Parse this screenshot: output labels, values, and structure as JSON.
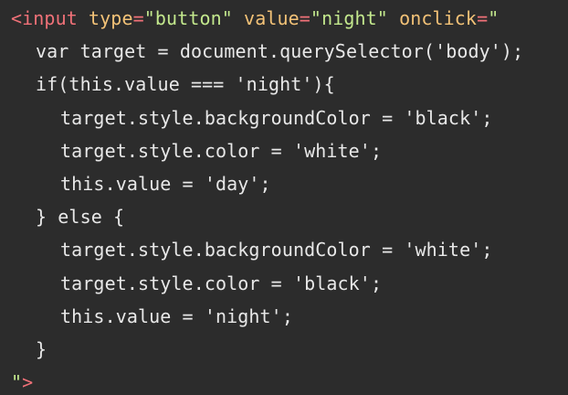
{
  "code": {
    "line1": {
      "tag": "<input",
      "attr_type": "type",
      "eq1": "=",
      "val_type": "\"button\"",
      "attr_value": "value",
      "eq2": "=",
      "val_value": "\"night\"",
      "attr_onclick": "onclick",
      "eq3": "=",
      "quote_open": "\""
    },
    "line2": "var target = document.querySelector('body');",
    "line3": "if(this.value === 'night'){",
    "line4": "target.style.backgroundColor = 'black';",
    "line5": "target.style.color = 'white';",
    "line6": "this.value = 'day';",
    "line7": "} else {",
    "line8": "target.style.backgroundColor = 'white';",
    "line9": "target.style.color = 'black';",
    "line10": "this.value = 'night';",
    "line11": "}",
    "line12": {
      "quote_close": "\"",
      "tag_close": ">"
    }
  },
  "colors": {
    "background": "#2c2c2c",
    "tag": "#f07178",
    "attribute": "#f3c277",
    "string": "#c3e88d",
    "text": "#e8e8e8"
  }
}
